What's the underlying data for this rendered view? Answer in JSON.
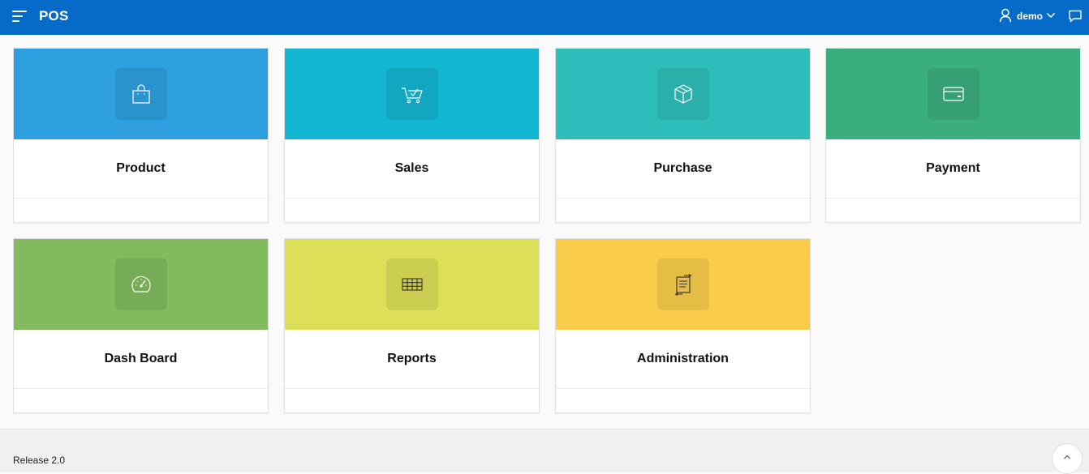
{
  "header": {
    "app_title": "POS",
    "menu_icon": "hamburger-menu-icon",
    "user": {
      "name": "demo",
      "icon": "user-icon",
      "chevron": "chevron-down-icon"
    },
    "feedback_icon": "chat-bubble-icon",
    "color": "#066bc8"
  },
  "cards": [
    {
      "label": "Product",
      "icon": "shopping-bag-icon",
      "color": "#2e9fdf"
    },
    {
      "label": "Sales",
      "icon": "cart-check-icon",
      "color": "#13b6d2"
    },
    {
      "label": "Purchase",
      "icon": "box-icon",
      "color": "#2ebeba"
    },
    {
      "label": "Payment",
      "icon": "credit-card-icon",
      "color": "#3bae7e"
    },
    {
      "label": "Dash Board",
      "icon": "speedometer-icon",
      "color": "#81bb5d"
    },
    {
      "label": "Reports",
      "icon": "table-grid-icon",
      "color": "#dddf57"
    },
    {
      "label": "Administration",
      "icon": "transfer-document-icon",
      "color": "#f9cc4a"
    }
  ],
  "footer": {
    "release": "Release 2.0",
    "scroll_top_icon": "chevron-up-icon"
  }
}
